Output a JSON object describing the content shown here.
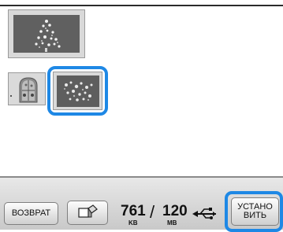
{
  "thumbnails": [
    {
      "name": "tree-design-large",
      "selected": false
    },
    {
      "name": "window-design",
      "selected": false
    },
    {
      "name": "flowers-design",
      "selected": true
    }
  ],
  "bottom_bar": {
    "back_label": "ВОЗВРАТ",
    "memory_used_value": "761",
    "memory_used_unit": "KB",
    "memory_total_value": "120",
    "memory_total_unit": "MB",
    "set_label_line1": "УСТАНО",
    "set_label_line2": "ВИТЬ"
  },
  "colors": {
    "selection": "#1e88e5",
    "button_face": "#e8e8e8"
  }
}
